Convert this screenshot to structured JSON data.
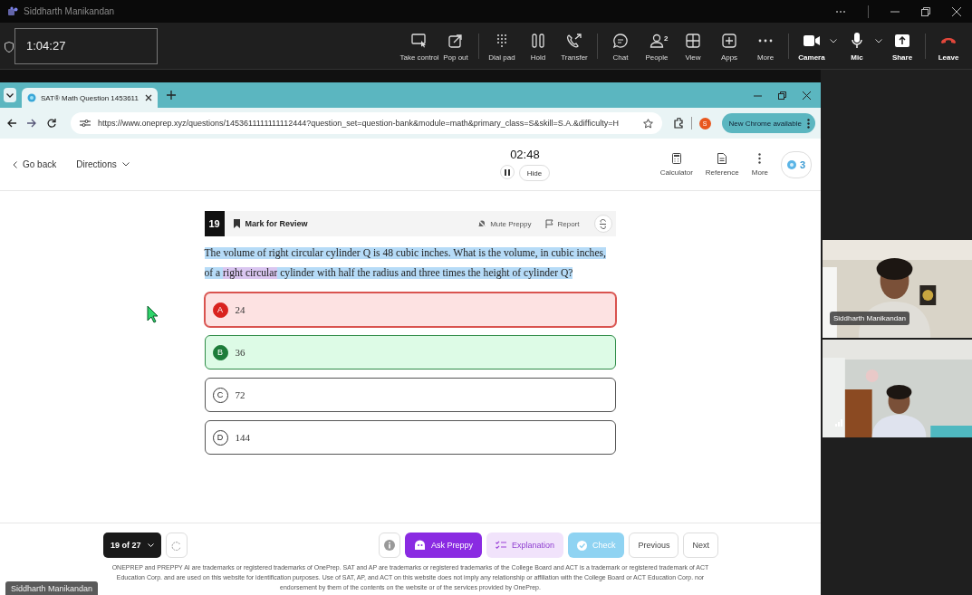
{
  "meeting": {
    "caller": "Siddharth Manikandan",
    "duration": "1:04:27",
    "tools": [
      {
        "label": "Take control"
      },
      {
        "label": "Pop out"
      },
      {
        "label": "Dial pad"
      },
      {
        "label": "Hold"
      },
      {
        "label": "Transfer"
      },
      {
        "label": "Chat"
      },
      {
        "label": "People",
        "badge": "2"
      },
      {
        "label": "View"
      },
      {
        "label": "Apps"
      },
      {
        "label": "More"
      },
      {
        "label": "Camera",
        "menu": true
      },
      {
        "label": "Mic",
        "menu": true
      },
      {
        "label": "Share"
      },
      {
        "label": "Leave"
      }
    ],
    "participants": [
      {
        "name": "Siddharth Manikandan",
        "kind": "picture"
      },
      {
        "kind": "picture"
      }
    ],
    "presenter_label": "Siddharth Manikandan"
  },
  "browser": {
    "tab_title": "SAT® Math Question 1453611",
    "url": "https://www.oneprep.xyz/questions/1453611111111112444?question_set=question-bank&module=math&primary_class=S&skill=S.A.&difficulty=H",
    "profile_initial": "S",
    "update_badge": "New Chrome available"
  },
  "page": {
    "back": "Go back",
    "directions": "Directions",
    "timer": "02:48",
    "hide": "Hide",
    "tools": [
      "Calculator",
      "Reference",
      "More"
    ],
    "streak": "3",
    "question_number": "19",
    "mark_review": "Mark for Review",
    "mute": "Mute Preppy",
    "report": "Report",
    "question": [
      {
        "text": "The volume of right circular cylinder Q is 48 cubic inches. What is the volume, in cubic inches, of a ",
        "color": "#b6dbf7"
      },
      {
        "text": "right circular",
        "color": "#d9c6f0"
      },
      {
        "text": " cylinder with half the radius and three times the height of cylinder Q?",
        "color": "#b6dbf7"
      }
    ],
    "choices": [
      {
        "letter": "A",
        "text": "24",
        "selected": true,
        "correct": false
      },
      {
        "letter": "B",
        "text": "36",
        "selected": false,
        "correct": true
      },
      {
        "letter": "C",
        "text": "72",
        "selected": false,
        "correct": false
      },
      {
        "letter": "D",
        "text": "144",
        "selected": false,
        "correct": false
      }
    ],
    "progress": "19 of 27",
    "buttons": [
      {
        "label": "Ask Preppy",
        "kind": "primary"
      },
      {
        "label": "Explanation",
        "kind": "soft"
      },
      {
        "label": "Check",
        "kind": "check"
      },
      {
        "label": "Previous",
        "kind": "outline"
      },
      {
        "label": "Next",
        "kind": "outline"
      }
    ],
    "legal": "ONEPREP and PREPPY AI are trademarks or registered trademarks of OnePrep. SAT and AP are trademarks or registered trademarks of the College Board and ACT is a trademark or registered trademark of ACT Education Corp. and are used on this website for identification purposes. Use of SAT, AP, and ACT on this website does not imply any relationship or affiliation with the College Board or ACT Education Corp. nor endorsement by them of the contents on the website or of the services provided by OnePrep."
  }
}
